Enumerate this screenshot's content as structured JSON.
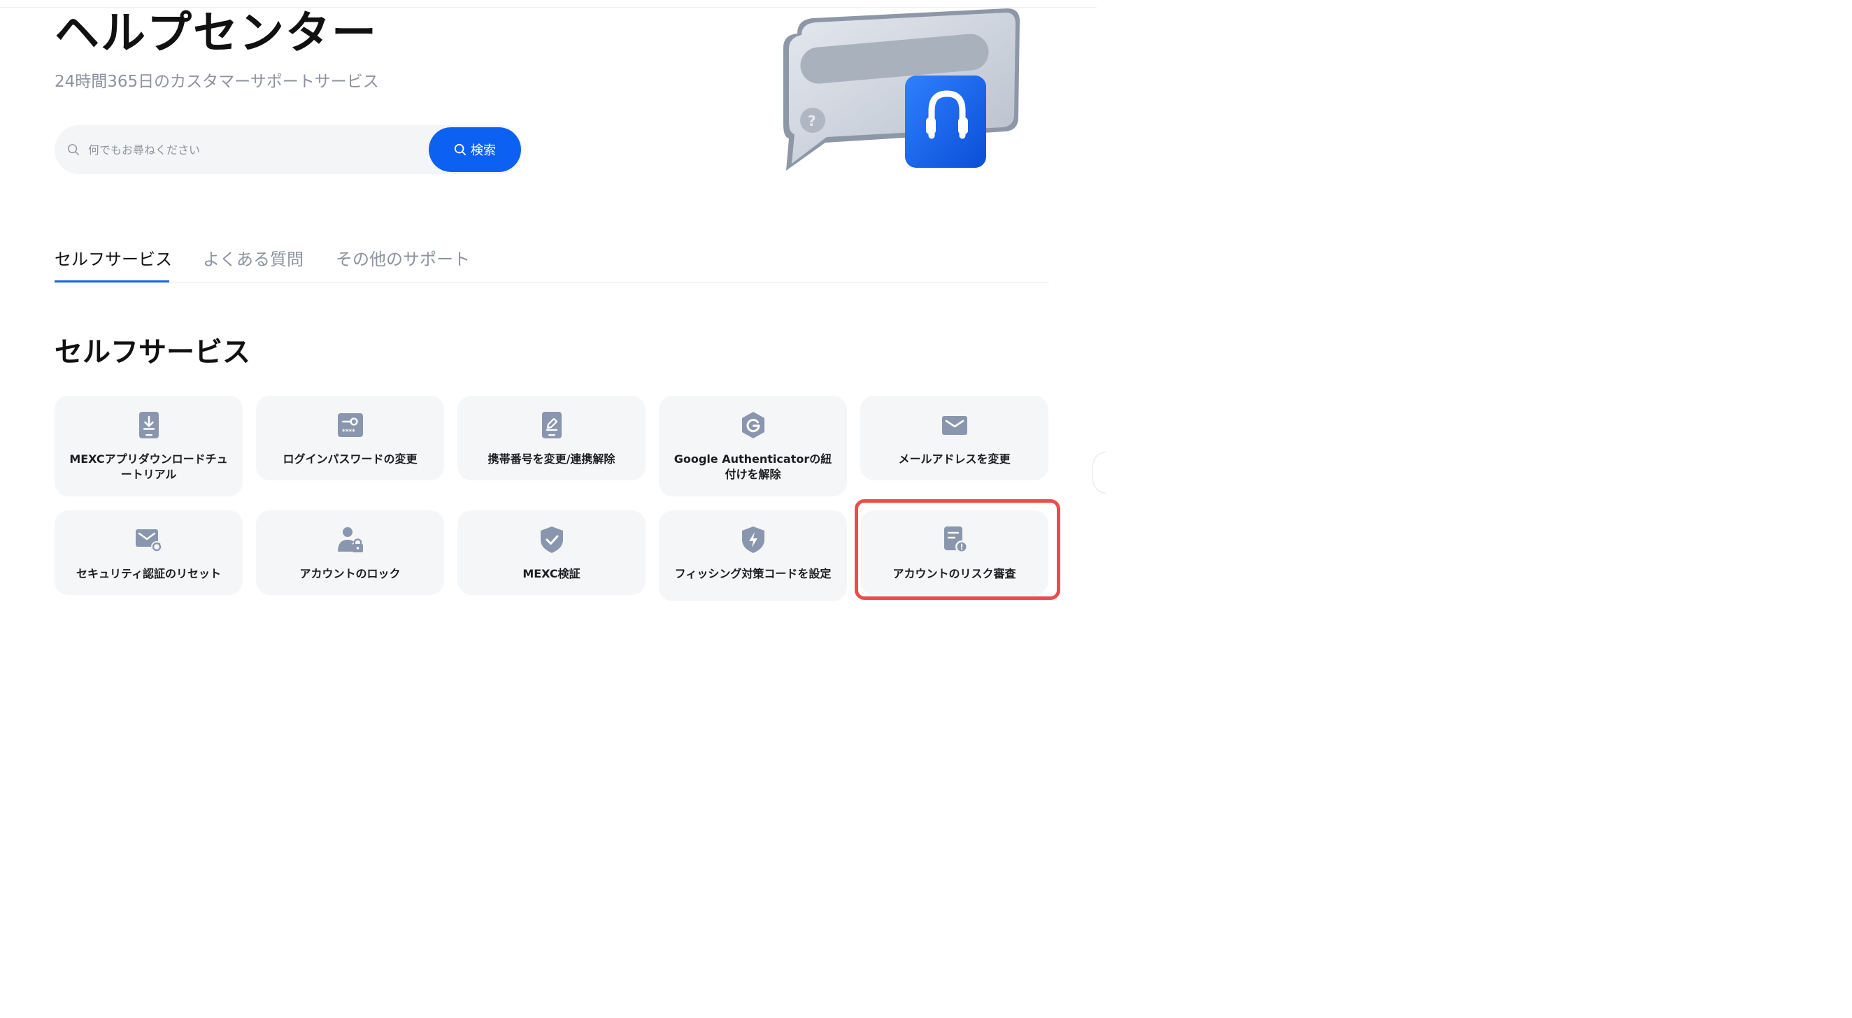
{
  "hero": {
    "title": "ヘルプセンター",
    "subtitle": "24時間365日のカスタマーサポートサービス"
  },
  "search": {
    "placeholder": "何でもお尋ねください",
    "button_label": "検索"
  },
  "tabs": [
    {
      "label": "セルフサービス",
      "active": true
    },
    {
      "label": "よくある質問",
      "active": false
    },
    {
      "label": "その他のサポート",
      "active": false
    }
  ],
  "section": {
    "title": "セルフサービス"
  },
  "cards": [
    {
      "label": "MEXCアプリダウンロードチュートリアル",
      "icon": "phone-download-icon"
    },
    {
      "label": "ログインパスワードの変更",
      "icon": "password-key-icon"
    },
    {
      "label": "携帯番号を変更/連携解除",
      "icon": "phone-edit-icon"
    },
    {
      "label": "Google Authenticatorの紐付けを解除",
      "icon": "google-authenticator-icon"
    },
    {
      "label": "メールアドレスを変更",
      "icon": "mail-icon"
    },
    {
      "label": "セキュリティ認証のリセット",
      "icon": "mail-reset-icon"
    },
    {
      "label": "アカウントのロック",
      "icon": "user-lock-icon"
    },
    {
      "label": "MEXC検証",
      "icon": "shield-check-icon"
    },
    {
      "label": "フィッシング対策コードを設定",
      "icon": "shield-bolt-icon"
    },
    {
      "label": "アカウントのリスク審査",
      "icon": "document-alert-icon"
    }
  ],
  "colors": {
    "accent": "#0d61f2",
    "highlight": "#ec4c4c",
    "icon": "#8a96ad"
  }
}
